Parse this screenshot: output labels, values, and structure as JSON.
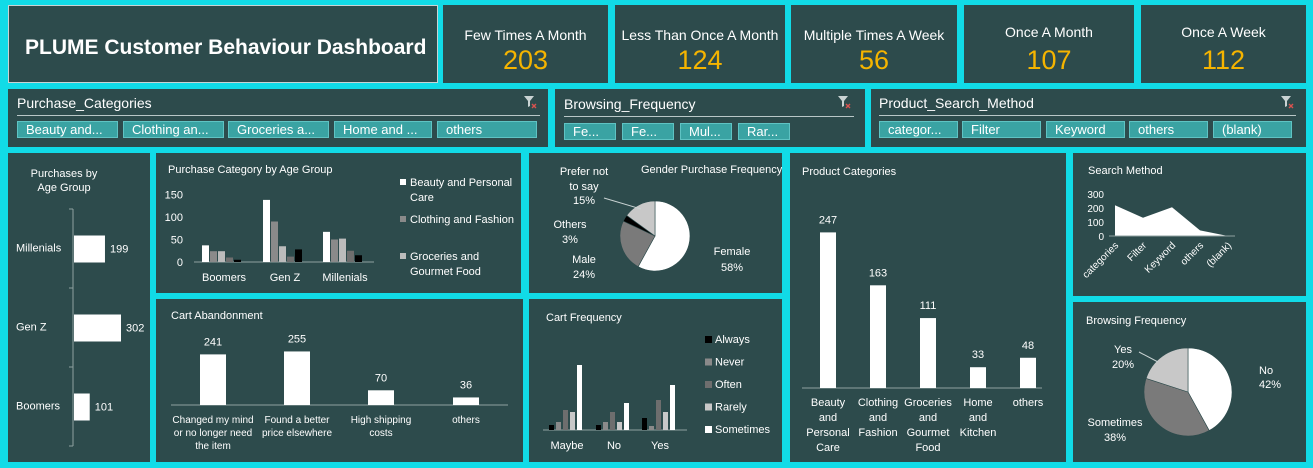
{
  "dashboard": {
    "title": "PLUME Customer Behaviour Dashboard"
  },
  "kpis": [
    {
      "label": "Few Times A Month",
      "value": "203"
    },
    {
      "label": "Less Than Once A Month",
      "value": "124"
    },
    {
      "label": "Multiple Times A Week",
      "value": "56"
    },
    {
      "label": "Once A Month",
      "value": "107"
    },
    {
      "label": "Once A Week",
      "value": "112"
    }
  ],
  "slicers": [
    {
      "title": "Purchase_Categories",
      "items": [
        "Beauty and...",
        "Clothing an...",
        "Groceries a...",
        "Home and ...",
        "others"
      ]
    },
    {
      "title": "Browsing_Frequency",
      "items": [
        "Fe...",
        "Fe...",
        "Mul...",
        "Rar..."
      ]
    },
    {
      "title": "Product_Search_Method",
      "items": [
        "categor...",
        "Filter",
        "Keyword",
        "others",
        "(blank)"
      ]
    }
  ],
  "colors": {
    "background": "#11dbe7",
    "panel": "#2d4b4c",
    "kpi_value": "#f5b400",
    "chip": "#3aa3a3"
  },
  "icons": {
    "slicer_clear": "clear-filter-icon"
  },
  "chart_data": [
    {
      "id": "purchases_by_age",
      "type": "bar",
      "orientation": "horizontal",
      "title": "Purchases by Age Group",
      "categories": [
        "Millenials",
        "Gen Z",
        "Boomers"
      ],
      "values": [
        199,
        302,
        101
      ]
    },
    {
      "id": "category_by_age",
      "type": "bar",
      "title": "Purchase Category by Age Group",
      "categories": [
        "Boomers",
        "Gen Z",
        "Millenials"
      ],
      "yticks": [
        "150",
        "100",
        "50",
        "0"
      ],
      "ylim": [
        0,
        150
      ],
      "legend_position": "right",
      "legend_labels": [
        "Beauty and Personal Care",
        "Clothing and Fashion",
        "Groceries and Gourmet Food"
      ],
      "series": [
        {
          "values": [
            37,
            138,
            67
          ],
          "color": "#ffffff"
        },
        {
          "values": [
            24,
            90,
            50
          ],
          "color": "#8a8a8a"
        },
        {
          "values": [
            24,
            35,
            52
          ],
          "color": "#bcbcbc"
        },
        {
          "values": [
            10,
            12,
            25
          ],
          "color": "#6e6e6e"
        },
        {
          "values": [
            5,
            28,
            15
          ],
          "color": "#000000"
        }
      ]
    },
    {
      "id": "gender_purchase_frequency",
      "type": "pie",
      "title": "Gender Purchase Frequency",
      "labels": [
        "Female",
        "Male",
        "Others",
        "Prefer not to say"
      ],
      "label_values": [
        "58%",
        "24%",
        "3%",
        "15%"
      ],
      "values": [
        58,
        24,
        3,
        15
      ],
      "colors": [
        "#ffffff",
        "#7a7a7a",
        "#000000",
        "#c8c8c8"
      ]
    },
    {
      "id": "product_categories",
      "type": "bar",
      "title": "Product Categories",
      "categories": [
        "Beauty and Personal Care",
        "Clothing and Fashion",
        "Groceries and Gourmet Food",
        "Home and Kitchen",
        "others"
      ],
      "category_lines": [
        [
          "Beauty",
          "and",
          "Personal",
          "Care"
        ],
        [
          "Clothing",
          "and",
          "Fashion"
        ],
        [
          "Groceries",
          "and",
          "Gourmet",
          "Food"
        ],
        [
          "Home",
          "and",
          "Kitchen"
        ],
        [
          "others"
        ]
      ],
      "values": [
        247,
        163,
        111,
        33,
        48
      ],
      "value_labels": [
        "247",
        "163",
        "111",
        "33",
        "48"
      ]
    },
    {
      "id": "search_method",
      "type": "area",
      "title": "Search Method",
      "categories": [
        "categories",
        "Filter",
        "Keyword",
        "others",
        "(blank)"
      ],
      "values": [
        220,
        130,
        205,
        40,
        0
      ],
      "yticks": [
        "300",
        "200",
        "100",
        "0"
      ],
      "ylim": [
        0,
        300
      ]
    },
    {
      "id": "cart_abandonment",
      "type": "bar",
      "title": "Cart Abandonment",
      "categories": [
        "Changed my mind or no longer need the item",
        "Found a better price elsewhere",
        "High shipping costs",
        "others"
      ],
      "category_lines": [
        [
          "Changed my mind",
          "or no longer need",
          "the item"
        ],
        [
          "Found a better",
          "price elsewhere"
        ],
        [
          "High shipping",
          "costs"
        ],
        [
          "others"
        ]
      ],
      "values": [
        241,
        255,
        70,
        36
      ],
      "value_labels": [
        "241",
        "255",
        "70",
        "36"
      ]
    },
    {
      "id": "cart_frequency",
      "type": "bar",
      "title": "Cart Frequency",
      "categories": [
        "Maybe",
        "No",
        "Yes"
      ],
      "legend_position": "right",
      "series": [
        {
          "name": "Always",
          "values": [
            5,
            5,
            12
          ],
          "color": "#000000"
        },
        {
          "name": "Never",
          "values": [
            8,
            8,
            4
          ],
          "color": "#8a8a8a"
        },
        {
          "name": "Often",
          "values": [
            20,
            18,
            30
          ],
          "color": "#6e6e6e"
        },
        {
          "name": "Rarely",
          "values": [
            18,
            8,
            18
          ],
          "color": "#c8c8c8"
        },
        {
          "name": "Sometimes",
          "values": [
            65,
            27,
            45
          ],
          "color": "#ffffff"
        }
      ]
    },
    {
      "id": "browsing_frequency",
      "type": "pie",
      "title": "Browsing Frequency",
      "labels": [
        "No",
        "Sometimes",
        "Yes"
      ],
      "label_values": [
        "42%",
        "38%",
        "20%"
      ],
      "values": [
        42,
        38,
        20
      ],
      "colors": [
        "#ffffff",
        "#7a7a7a",
        "#c8c8c8"
      ]
    }
  ]
}
